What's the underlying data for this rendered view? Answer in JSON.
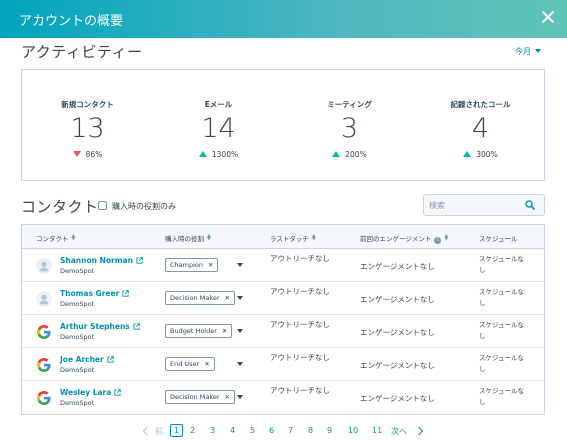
{
  "header": {
    "title": "アカウントの概要"
  },
  "activity": {
    "title": "アクティビティー",
    "period": "今月",
    "stats": [
      {
        "label": "新規コンタクト",
        "value": "13",
        "change": "86%",
        "direction": "down"
      },
      {
        "label": "Eメール",
        "value": "14",
        "change": "1300%",
        "direction": "up"
      },
      {
        "label": "ミーティング",
        "value": "3",
        "change": "200%",
        "direction": "up"
      },
      {
        "label": "記録されたコール",
        "value": "4",
        "change": "300%",
        "direction": "up"
      }
    ]
  },
  "contacts": {
    "title": "コンタクト",
    "filter_label": "購入時の役割のみ",
    "search_placeholder": "検索",
    "columns": [
      "コンタクト",
      "購入時の役割",
      "ラストタッチ",
      "前回のエンゲージメント",
      "スケジュール"
    ],
    "rows": [
      {
        "name": "Shannon Norman",
        "company": "DemoSpot",
        "role": "Champion",
        "avatar": "person",
        "last_touch": "アウトリーチなし",
        "engagement": "エンゲージメントなし",
        "schedule": "スケジュールなし"
      },
      {
        "name": "Thomas Greer",
        "company": "DemoSpot",
        "role": "Decision Maker",
        "avatar": "person",
        "last_touch": "アウトリーチなし",
        "engagement": "エンゲージメントなし",
        "schedule": "スケジュールなし"
      },
      {
        "name": "Arthur Stephens",
        "company": "DemoSpot",
        "role": "Budget Holder",
        "avatar": "google",
        "last_touch": "アウトリーチなし",
        "engagement": "エンゲージメントなし",
        "schedule": "スケジュールなし"
      },
      {
        "name": "Joe Archer",
        "company": "DemoSpot",
        "role": "End User",
        "avatar": "google",
        "last_touch": "アウトリーチなし",
        "engagement": "エンゲージメントなし",
        "schedule": "スケジュールなし"
      },
      {
        "name": "Wesley Lara",
        "company": "DemoSpot",
        "role": "Decision Maker",
        "avatar": "google",
        "last_touch": "アウトリーチなし",
        "engagement": "エンゲージメントなし",
        "schedule": "スケジュールなし"
      }
    ]
  },
  "pagination": {
    "prev_label": "前",
    "next_label": "次へ",
    "pages": [
      "1",
      "2",
      "3",
      "4",
      "5",
      "6",
      "7",
      "8",
      "9",
      "10",
      "11"
    ],
    "current": "1"
  },
  "colors": {
    "accent": "#0091ae",
    "up": "#00bda5",
    "down": "#f2545b",
    "header_start": "#00a4bd",
    "header_end": "#5fc4b6"
  }
}
